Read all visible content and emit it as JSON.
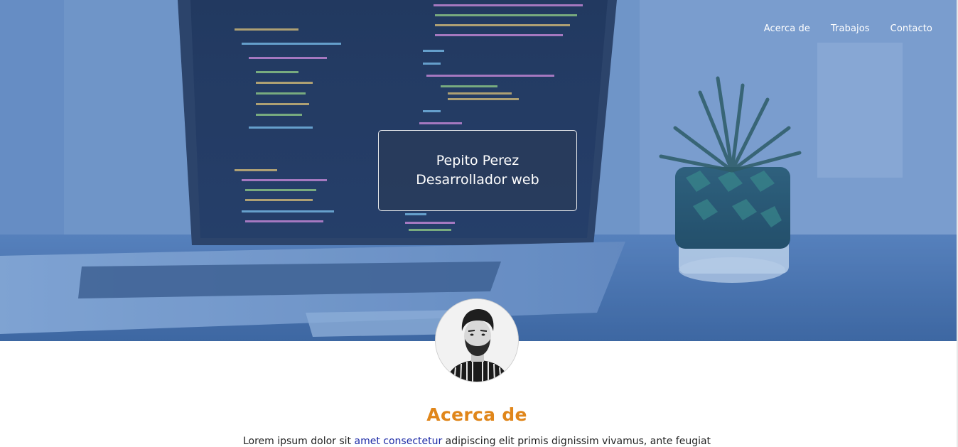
{
  "nav": {
    "items": [
      {
        "label": "Acerca de"
      },
      {
        "label": "Trabajos"
      },
      {
        "label": "Contacto"
      }
    ]
  },
  "hero": {
    "name": "Pepito Perez",
    "role": "Desarrollador web"
  },
  "about": {
    "title": "Acerca de",
    "text_before": "Lorem ipsum dolor sit ",
    "link_text": "amet consectetur",
    "text_after": " adipiscing elit primis dignissim vivamus, ante feugiat"
  },
  "colors": {
    "accent": "#e0861a",
    "link": "#1c2aa6",
    "hero_tint": "#4f76ad"
  },
  "icons": {
    "avatar": "profile-photo-avatar"
  }
}
